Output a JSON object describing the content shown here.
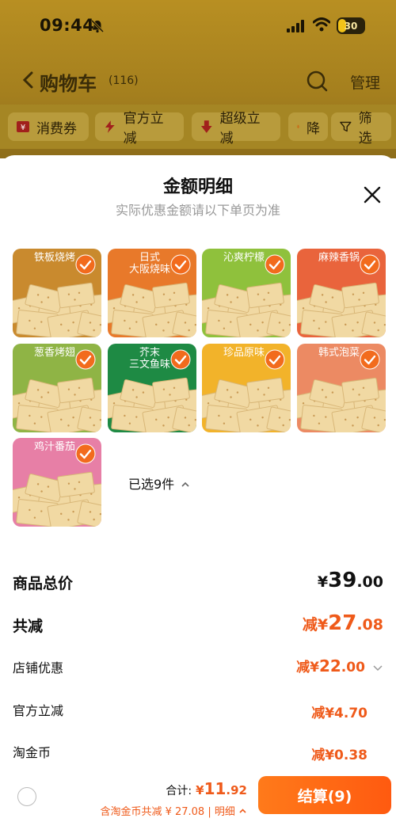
{
  "status": {
    "time": "09:44",
    "battery": "30"
  },
  "nav": {
    "title": "购物车",
    "count": "(116)",
    "manage": "管理"
  },
  "filters": [
    {
      "label": "消费券"
    },
    {
      "label": "官方立减"
    },
    {
      "label": "超级立减"
    },
    {
      "label": "降"
    },
    {
      "label": "筛选"
    }
  ],
  "sheet": {
    "title": "金额明细",
    "subtitle": "实际优惠金额请以下单页为准",
    "items": [
      {
        "label": "铁板烧烤",
        "bg": "#c98a2e"
      },
      {
        "label": "日式\n大阪烧味",
        "bg": "#e8792a"
      },
      {
        "label": "沁爽柠檬",
        "bg": "#8fc13c"
      },
      {
        "label": "麻辣香锅",
        "bg": "#e9643c"
      },
      {
        "label": "葱香烤翅",
        "bg": "#8fb445"
      },
      {
        "label": "芥末\n三文鱼味",
        "bg": "#1e8a44"
      },
      {
        "label": "珍品原味",
        "bg": "#f2b32a"
      },
      {
        "label": "韩式泡菜",
        "bg": "#ec8a63"
      },
      {
        "label": "鸡汁番茄",
        "bg": "#e77fa6"
      }
    ],
    "selected_count": "已选9件",
    "rows": {
      "total_label": "商品总价",
      "total_currency": "¥",
      "total_int": "39",
      "total_dec": ".00",
      "reduce_label": "共减",
      "reduce_prefix": "减¥",
      "reduce_int": "27",
      "reduce_dec": ".08",
      "store_label": "店铺优惠",
      "store_prefix": "减¥",
      "store_int": "22",
      "store_dec": ".00",
      "official_label": "官方立减",
      "official_value": "减¥4.70",
      "coin_label": "淘金币",
      "coin_value": "减¥0.38"
    }
  },
  "footer": {
    "total_label": "合计:",
    "total_currency": "¥",
    "total_int": "11",
    "total_dec": ".92",
    "detail_text": "含淘金币共减 ¥ 27.08 | 明细",
    "checkout_label": "结算(9)"
  },
  "colors": {
    "accent": "#ef5a1a",
    "checkout": "#ff6a14",
    "check": "#f26b1d"
  }
}
